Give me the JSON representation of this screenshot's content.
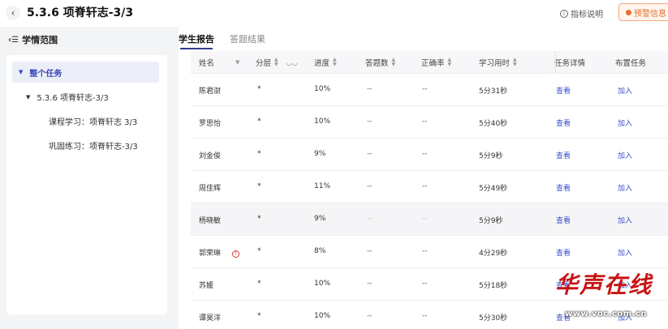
{
  "header": {
    "title": "5.3.6 项脊轩志-3/3",
    "help_label": "指标说明",
    "warning_label": "预警信息"
  },
  "sidebar": {
    "heading": "学情范围",
    "items": [
      {
        "label": "整个任务"
      },
      {
        "label": "5.3.6 项脊轩志-3/3"
      },
      {
        "label": "课程学习：项脊轩志 3/3"
      },
      {
        "label": "巩固练习：项脊轩志-3/3"
      }
    ]
  },
  "tabs": [
    {
      "label": "学生报告",
      "active": true
    },
    {
      "label": "答题结果",
      "active": false
    }
  ],
  "table": {
    "headers": {
      "name": "姓名",
      "level": "分层",
      "progress": "进度",
      "answers": "答题数",
      "accuracy": "正确率",
      "time": "学习用时",
      "detail": "任务详情",
      "assign": "布置任务"
    },
    "rows": [
      {
        "name": "陈君澍",
        "level": "*",
        "progress": "10%",
        "answers": "--",
        "accuracy": "--",
        "time": "5分31秒",
        "detail": "查看",
        "assign": "加入",
        "warning": false
      },
      {
        "name": "罗思怡",
        "level": "*",
        "progress": "10%",
        "answers": "--",
        "accuracy": "--",
        "time": "5分40秒",
        "detail": "查看",
        "assign": "加入",
        "warning": false
      },
      {
        "name": "刘金俊",
        "level": "*",
        "progress": "9%",
        "answers": "--",
        "accuracy": "--",
        "time": "5分9秒",
        "detail": "查看",
        "assign": "加入",
        "warning": false
      },
      {
        "name": "周佳辉",
        "level": "*",
        "progress": "11%",
        "answers": "--",
        "accuracy": "--",
        "time": "5分49秒",
        "detail": "查看",
        "assign": "加入",
        "warning": false
      },
      {
        "name": "杨晓敏",
        "level": "*",
        "progress": "9%",
        "answers": "--",
        "accuracy": "--",
        "time": "5分9秒",
        "detail": "查看",
        "assign": "加入",
        "warning": false
      },
      {
        "name": "郭荣琳",
        "level": "*",
        "progress": "8%",
        "answers": "--",
        "accuracy": "--",
        "time": "4分29秒",
        "detail": "查看",
        "assign": "加入",
        "warning": true
      },
      {
        "name": "苏媛",
        "level": "*",
        "progress": "10%",
        "answers": "--",
        "accuracy": "--",
        "time": "5分18秒",
        "detail": "查看",
        "assign": "加入",
        "warning": false
      },
      {
        "name": "谭昊洋",
        "level": "*",
        "progress": "10%",
        "answers": "--",
        "accuracy": "--",
        "time": "5分30秒",
        "detail": "查看",
        "assign": "加入",
        "warning": false
      }
    ]
  },
  "watermark": {
    "brand": "华声在线",
    "url": "www.voc.com.cn"
  },
  "colors": {
    "accent": "#3a4fc7",
    "tab_underline": "#2f3b8c",
    "warning": "#e46f2c",
    "alert": "#dd3333"
  }
}
